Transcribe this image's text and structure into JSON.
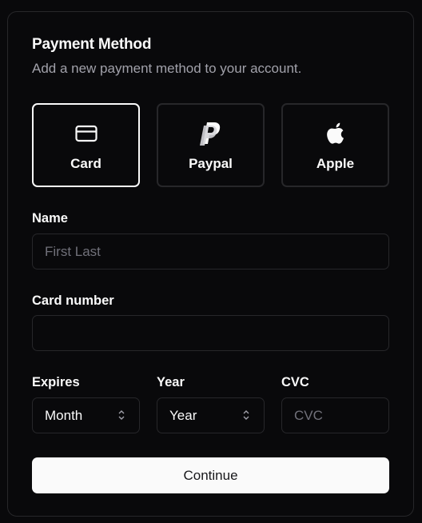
{
  "header": {
    "title": "Payment Method",
    "subtitle": "Add a new payment method to your account."
  },
  "methods": [
    {
      "label": "Card",
      "icon": "credit-card-icon",
      "selected": true
    },
    {
      "label": "Paypal",
      "icon": "paypal-icon",
      "selected": false
    },
    {
      "label": "Apple",
      "icon": "apple-icon",
      "selected": false
    }
  ],
  "form": {
    "name_label": "Name",
    "name_placeholder": "First Last",
    "name_value": "",
    "card_label": "Card number",
    "card_placeholder": "",
    "card_value": "",
    "expires_label": "Expires",
    "month_value": "Month",
    "year_label": "Year",
    "year_value": "Year",
    "cvc_label": "CVC",
    "cvc_placeholder": "CVC",
    "cvc_value": ""
  },
  "actions": {
    "continue_label": "Continue"
  },
  "colors": {
    "background": "#09090b",
    "border": "#27272a",
    "text": "#fafafa",
    "muted": "#a1a1aa",
    "placeholder": "#71717a",
    "button_bg": "#fafafa",
    "button_text": "#18181b"
  }
}
